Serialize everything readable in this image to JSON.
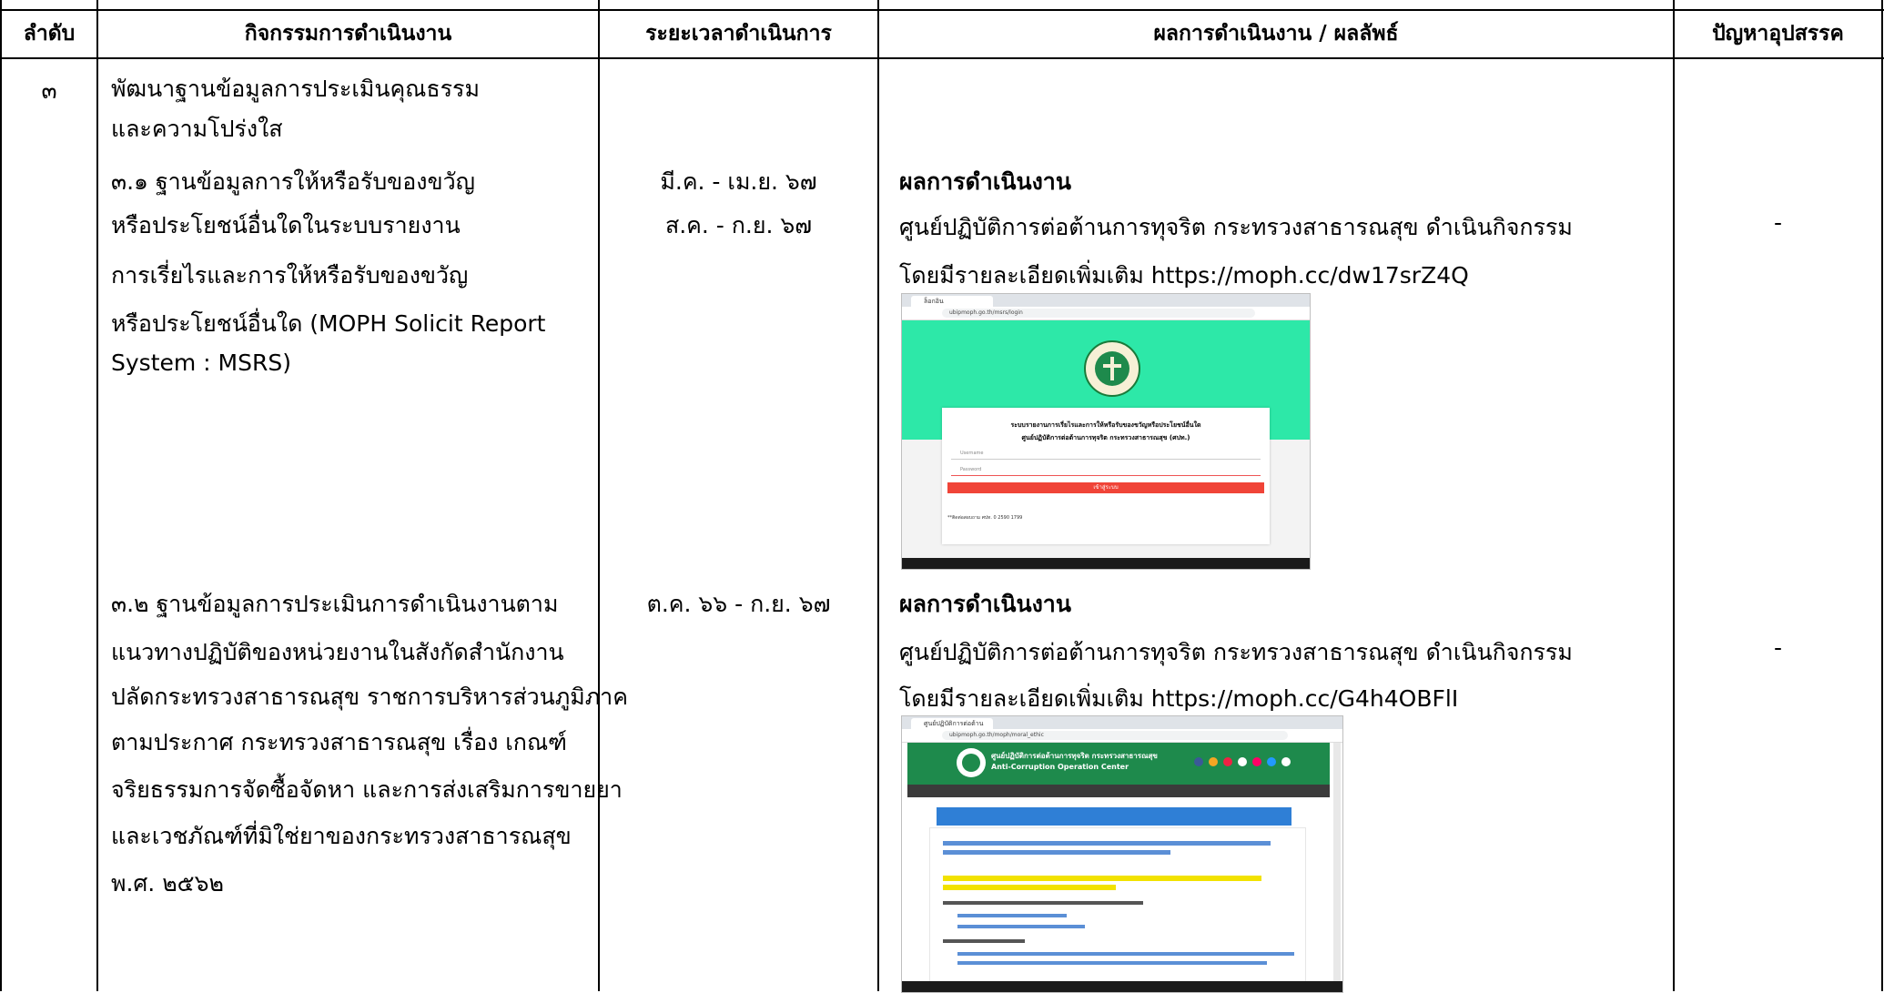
{
  "headers": {
    "col1": "ลำดับ",
    "col2": "กิจกรรมการดำเนินงาน",
    "col3": "ระยะเวลาดำเนินการ",
    "col4": "ผลการดำเนินงาน / ผลลัพธ์",
    "col5": "ปัญหาอุปสรรค"
  },
  "row": {
    "number": "๓",
    "activity_title": [
      "พัฒนาฐานข้อมูลการประเมินคุณธรรม",
      "และความโปร่งใส"
    ],
    "items": [
      {
        "activity_lines": [
          "๓.๑ ฐานข้อมูลการให้หรือรับของขวัญ",
          "หรือประโยชน์อื่นใดในระบบรายงาน",
          "การเรี่ยไรและการให้หรือรับของขวัญ",
          "หรือประโยชน์อื่นใด (MOPH Solicit Report",
          "System : MSRS)"
        ],
        "periods": [
          "มี.ค. - เม.ย. ๖๗",
          "ส.ค. - ก.ย. ๖๗"
        ],
        "result_heading": "ผลการดำเนินงาน",
        "result_lines": [
          "ศูนย์ปฏิบัติการต่อต้านการทุจริต กระทรวงสาธารณสุข ดำเนินกิจกรรม",
          "โดยมีรายละเอียดเพิ่มเติม https://moph.cc/dw17srZ4Q"
        ],
        "problem": "-",
        "screenshot": {
          "tab_title": "ล็อกอิน",
          "url": "ubipmoph.go.th/msrs/login",
          "form_title": "ระบบรายงานการเรี่ยไรและการให้หรือรับของขวัญหรือประโยชน์อื่นใด",
          "form_subtitle": "ศูนย์ปฏิบัติการต่อต้านการทุจริต กระทรวงสาธารณสุข (ศปท.)",
          "username_placeholder": "Username",
          "password_placeholder": "Password",
          "login_button": "เข้าสู่ระบบ",
          "footer": "**ติดต่อสอบถาม ศปท. 0 2590 1799",
          "accent": "#2de8a8",
          "button_color": "#f04438"
        }
      },
      {
        "activity_lines": [
          "๓.๒ ฐานข้อมูลการประเมินการดำเนินงานตาม",
          "แนวทางปฏิบัติของหน่วยงานในสังกัดสำนักงาน",
          "ปลัดกระทรวงสาธารณสุข ราชการบริหารส่วนภูมิภาค",
          "ตามประกาศ กระทรวงสาธารณสุข เรื่อง เกณฑ์",
          "จริยธรรมการจัดซื้อจัดหา และการส่งเสริมการขายยา",
          "และเวชภัณฑ์ที่มิใช่ยาของกระทรวงสาธารณสุข",
          "พ.ศ. ๒๕๖๒"
        ],
        "periods": [
          "ต.ค. ๖๖ - ก.ย. ๖๗"
        ],
        "result_heading": "ผลการดำเนินงาน",
        "result_lines": [
          "ศูนย์ปฏิบัติการต่อต้านการทุจริต กระทรวงสาธารณสุข ดำเนินกิจกรรม",
          "โดยมีรายละเอียดเพิ่มเติม https://moph.cc/G4h4OBFlI"
        ],
        "problem": "-",
        "screenshot": {
          "tab_title": "ศูนย์ปฏิบัติการต่อต้าน",
          "url": "ubipmoph.go.th/moph/moral_ethic",
          "site_title": "ศูนย์ปฏิบัติการต่อต้านการทุจริต กระทรวงสาธารณสุข",
          "site_subtitle": "Anti-Corruption Operation Center",
          "header_color": "#1e8a4c",
          "menu_color": "#3b3b3b"
        }
      }
    ]
  }
}
